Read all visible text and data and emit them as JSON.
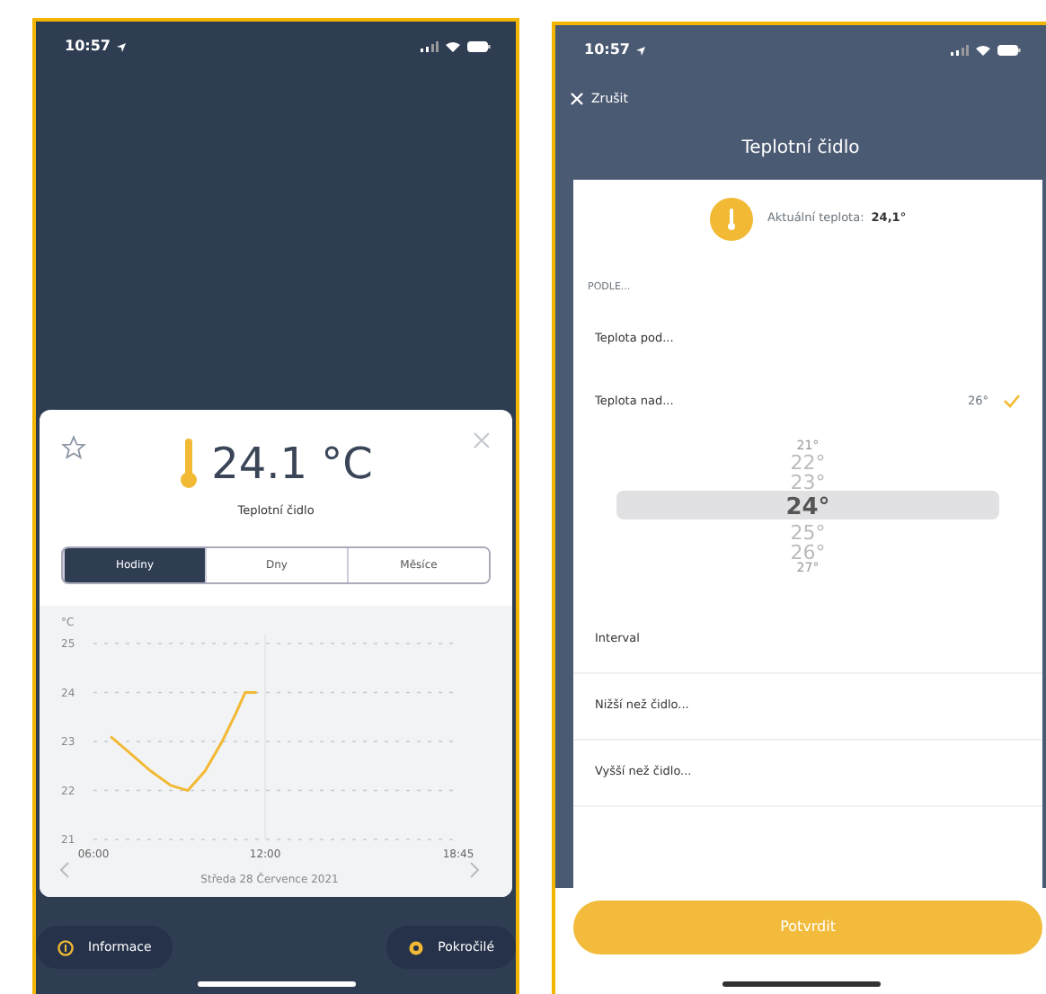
{
  "detail_screen": {
    "status_bar": {
      "time": "10:57"
    },
    "temperature": "24.1 °C",
    "sensor_name": "Teplotní čidlo",
    "tabs": [
      {
        "label": "Hodiny",
        "selected": true
      },
      {
        "label": "Dny",
        "selected": false
      },
      {
        "label": "Měsíce",
        "selected": false
      }
    ],
    "chart": {
      "chart_data": {
        "type": "line",
        "ylabel": "°C",
        "x": [
          6.6,
          7.2,
          8.0,
          8.7,
          9.3,
          9.9,
          10.5,
          11.0,
          11.3,
          11.7
        ],
        "grid": true,
        "ref_lines": [
          {
            "axis": "x",
            "value": 12
          }
        ],
        "series": [
          {
            "color": "#f2b935",
            "values": [
              23.1,
              22.8,
              22.4,
              22.1,
              22.0,
              22.4,
              23.0,
              23.6,
              24.0,
              24.0
            ]
          }
        ],
        "xlim": [
          6,
          18.75
        ],
        "ylim": [
          21,
          25
        ],
        "yticks": [
          21,
          22,
          23,
          24,
          25
        ],
        "xticks": [
          {
            "value": 6,
            "label": "06:00"
          },
          {
            "value": 12,
            "label": "12:00"
          },
          {
            "value": 18.75,
            "label": "18:45"
          }
        ]
      },
      "date": "Středa 28 Července 2021"
    },
    "buttons": [
      {
        "label": "Informace"
      },
      {
        "label": "Pokročilé"
      }
    ]
  },
  "settings_screen": {
    "status_bar": {
      "time": "10:57"
    },
    "cancel": "Zrušit",
    "title": "Teplotní čidlo",
    "current_label": "Aktuální teplota:",
    "current_value": "24,1°",
    "section": "PODLE...",
    "options": [
      {
        "label": "Teplota pod...",
        "checked": false
      },
      {
        "label": "Teplota nad...",
        "value": "26°",
        "checked": true
      }
    ],
    "picker": [
      {
        "label": "21°",
        "selected": false
      },
      {
        "label": "22°",
        "selected": false
      },
      {
        "label": "23°",
        "selected": false
      },
      {
        "label": "24°",
        "selected": true
      },
      {
        "label": "25°",
        "selected": false
      },
      {
        "label": "26°",
        "selected": false
      },
      {
        "label": "27°",
        "selected": false
      }
    ],
    "rows": [
      "Interval",
      "Nižší než čidlo...",
      "Vyšší než čidlo..."
    ],
    "confirm": "Potvrdit"
  }
}
